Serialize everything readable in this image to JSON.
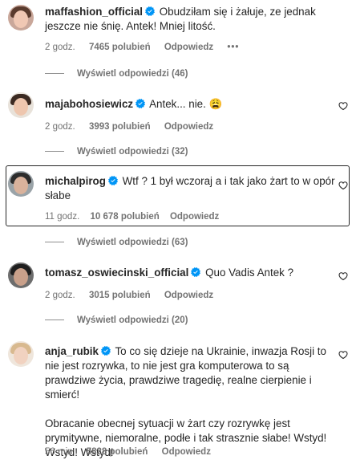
{
  "comments": [
    {
      "username": "maffashion_official",
      "text": "Obudziłam się i żałuje, ze jednak jeszcze nie śnię. Antek! Mniej litość.",
      "time": "2 godz.",
      "likes": "7465 polubień",
      "reply": "Odpowiedz",
      "more": "•••",
      "view_replies": "Wyświetl odpowiedzi (46)"
    },
    {
      "username": "majabohosiewicz",
      "text": "Antek... nie. 😩",
      "time": "2 godz.",
      "likes": "3993 polubień",
      "reply": "Odpowiedz",
      "view_replies": "Wyświetl odpowiedzi (32)"
    },
    {
      "username": "michalpirog",
      "text": "Wtf ? 1 był wczoraj a i tak jako żart to w opór słabe",
      "time": "11 godz.",
      "likes": "10 678 polubień",
      "reply": "Odpowiedz",
      "view_replies": "Wyświetl odpowiedzi (63)"
    },
    {
      "username": "tomasz_oswiecinski_official",
      "text": "Quo Vadis Antek ?",
      "time": "2 godz.",
      "likes": "3015 polubień",
      "reply": "Odpowiedz",
      "view_replies": "Wyświetl odpowiedzi (20)"
    },
    {
      "username": "anja_rubik",
      "text": "To co się dzieje na Ukrainie, inwazja Rosji to nie jest rozrywka, to nie jest gra komputerowa to są prawdziwe życia, prawdziwe tragedię, realne cierpienie i smierć!",
      "text2": "Obracanie obecnej sytuacji w żart czy rozrywkę jest prymitywne, niemoralne, podłe i tak strasznie słabe! Wstyd! Wstyd! Wstyd!",
      "time": "56 min",
      "likes": "5828 polubień",
      "reply": "Odpowiedz"
    }
  ],
  "colors": {
    "verified": "#0095f6",
    "text": "#262626",
    "secondary": "#737373"
  }
}
